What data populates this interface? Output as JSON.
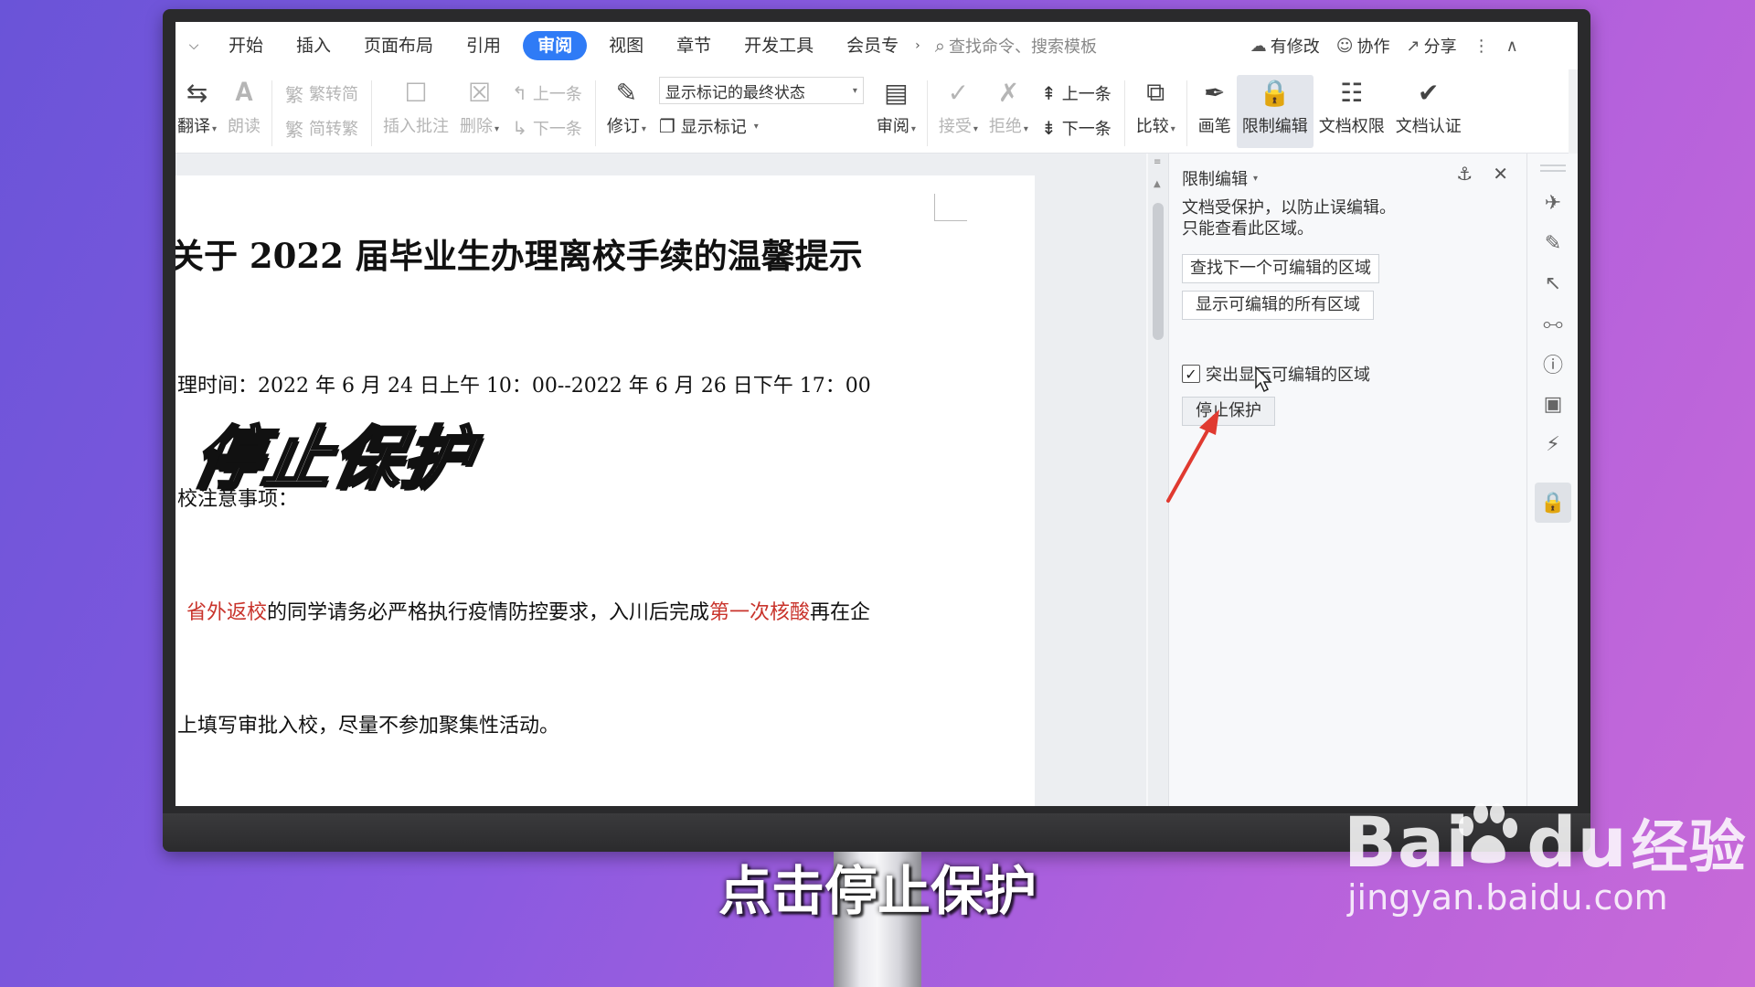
{
  "menubar": {
    "toggle_icon": "chevron-down-icon",
    "tabs": [
      "开始",
      "插入",
      "页面布局",
      "引用",
      "审阅",
      "视图",
      "章节",
      "开发工具",
      "会员专"
    ],
    "active_tab": "审阅",
    "more_icon": "chevron-right-icon",
    "search_placeholder": "查找命令、搜索模板",
    "right": {
      "modified": "有修改",
      "collab": "协作",
      "share": "分享"
    }
  },
  "ribbon": {
    "translate": "翻译",
    "read_aloud": "朗读",
    "trad_to_simp": "繁转简",
    "simp_to_trad": "简转繁",
    "insert_comment": "插入批注",
    "delete": "删除",
    "prev_comment": "上一条",
    "next_comment": "下一条",
    "revise": "修订",
    "markup_select": "显示标记的最终状态",
    "show_markup": "显示标记",
    "review": "审阅",
    "accept": "接受",
    "reject": "拒绝",
    "prev_change": "上一条",
    "next_change": "下一条",
    "compare": "比较",
    "pen": "画笔",
    "restrict_edit": "限制编辑",
    "doc_permission": "文档权限",
    "doc_auth": "文档认证"
  },
  "document": {
    "title": "关于 2022 届毕业生办理离校手续的温馨提示",
    "time_line": "理时间：2022 年 6 月 24 日上午 10：00--2022 年 6 月 26 日下午 17：00",
    "notes_line": "校注意事项：",
    "para1_red1": "省外返校",
    "para1_mid": "的同学请务必严格执行疫情防控要求，入川后完成",
    "para1_red2": "第一次核酸",
    "para1_end": "再在企",
    "para2": "上填写审批入校，尽量不参加聚集性活动。",
    "overlay": "停止保护"
  },
  "panel": {
    "title": "限制编辑",
    "desc1": "文档受保护，以防止误编辑。",
    "desc2": "只能查看此区域。",
    "find_next": "查找下一个可编辑的区域",
    "show_all": "显示可编辑的所有区域",
    "highlight": "突出显示可编辑的区域",
    "highlight_checked": true,
    "stop_protect": "停止保护"
  },
  "icon_strip": [
    "rocket-icon",
    "pen-icon",
    "pointer-icon",
    "sliders-icon",
    "help-icon",
    "image-icon",
    "lightning-icon",
    "lock-icon"
  ],
  "caption": "点击停止保护",
  "watermark": {
    "logo_text": "Bai",
    "logo_text2": "du",
    "logo_cn": "经验",
    "url": "jingyan.baidu.com"
  },
  "colors": {
    "accent": "#2f7bf6",
    "red_text": "#c9342c",
    "arrow": "#e03a30"
  }
}
